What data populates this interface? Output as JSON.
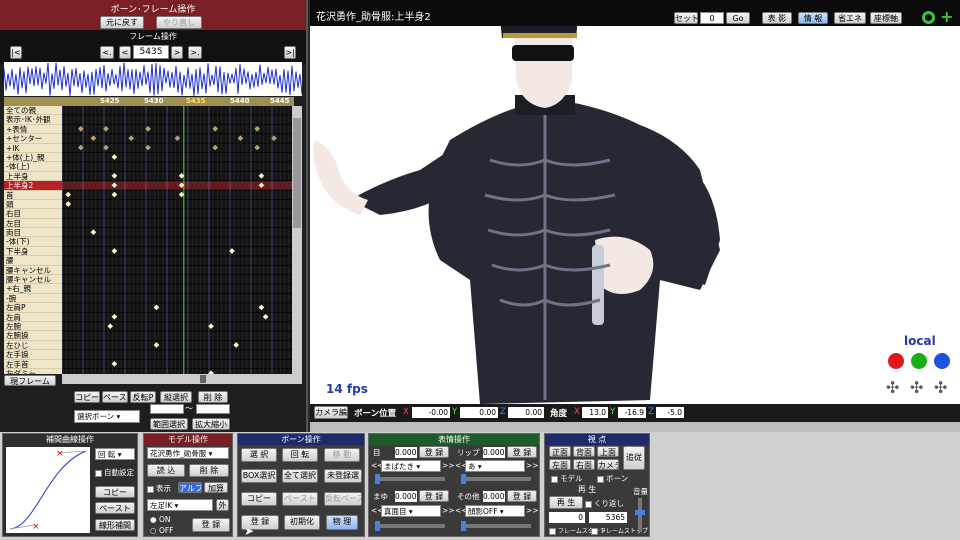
{
  "bone_frame_panel": {
    "title": "ボーン･フレーム操作",
    "undo_label": "元に戻す",
    "redo_label": "やり直し"
  },
  "frame_ops": {
    "title": "フレーム操作",
    "first_label": "|<",
    "prev_key_label": "<.",
    "prev_label": "<",
    "frame_value": "5435",
    "next_label": ">",
    "next_key_label": ">.",
    "last_label": ">|"
  },
  "timeline": {
    "frame_ticks": [
      "5425",
      "5430",
      "5435",
      "5440",
      "5445"
    ],
    "bones": [
      "全ての親",
      "表示･IK･外観",
      "+表情",
      "+センター",
      "+IK",
      "+体(上)_親",
      "-体(上)",
      "上半身",
      "上半身2",
      "首",
      "頭",
      "右目",
      "左目",
      "両目",
      "-体(下)",
      "下半身",
      "腰",
      "腰キャンセル",
      "腰キャンセル",
      "+右_親",
      "-腕",
      "左肩P",
      "左肩",
      "左腕",
      "左腕捩",
      "左ひじ",
      "左手捩",
      "左手首",
      "左ダミー"
    ],
    "current_frame_label": "現フレーム",
    "copy_label": "コピー",
    "paste_label": "ペースト",
    "reverse_paste_label": "反転P",
    "vertical_select_label": "縦選択",
    "delete_label": "削 除",
    "select_bone_label": "選択ボーン",
    "range_tilde": "～",
    "range_select_label": "範囲選択",
    "zoom_label": "拡大縮小"
  },
  "viewport": {
    "title": "花沢勇作_勛骨服:上半身2",
    "set_label": "セット",
    "set_value": "0",
    "go_label": "Go",
    "shadow_label": "表 影",
    "info_label": "情 報",
    "energy_label": "省エネ",
    "axis_label": "座標軸",
    "fps": "14 fps",
    "local_label": "local"
  },
  "position_bar": {
    "camera_label": "カメラ編",
    "pos_title": "ボーン位置",
    "x_label": "X",
    "x": "-0.00",
    "y_label": "Y",
    "y": "0.00",
    "z_label": "Z",
    "z": "0.00",
    "angle_title": "角度",
    "ax": "13.0",
    "ay": "-16.9",
    "az": "-5.0"
  },
  "interp_panel": {
    "title": "補間曲線操作",
    "rotate_select": "回 転",
    "auto_label": "自動設定",
    "copy_label": "コピー",
    "paste_label": "ペースト",
    "linear_label": "線形補間"
  },
  "model_panel": {
    "title": "モデル操作",
    "model_select": "花沢勇作_勛骨服",
    "load_label": "読 込",
    "delete_label": "削 除",
    "display_label": "表示",
    "alpha_label": "アルファ",
    "add_label": "加算",
    "ik_select": "左足IK",
    "outer_label": "外",
    "on_label": "ON",
    "off_label": "OFF",
    "register_label": "登 録"
  },
  "bone_panel": {
    "title": "ボーン操作",
    "select_label": "選 択",
    "rotate_label": "回 転",
    "move_label": "移 動",
    "box_select_label": "BOX選択",
    "select_all_label": "全て選択",
    "unreg_select_label": "未登録選",
    "copy_label": "コピー",
    "paste_label": "ペースト",
    "reverse_paste_label": "反転ペースト",
    "register_label": "登 録",
    "reset_label": "初期化",
    "physics_label": "物 理"
  },
  "morph_panel": {
    "title": "表情操作",
    "eye_label": "目",
    "eye_value": "0.000",
    "eye_select": "まばたき",
    "lip_label": "リップ",
    "lip_value": "0.000",
    "lip_select": "あ",
    "brow_label": "まゆ",
    "brow_value": "0.000",
    "brow_select": "真面目",
    "other_label": "その他",
    "other_value": "0.000",
    "other_select": "顔影OFF",
    "register_label": "登 録",
    "prev_label": "<<",
    "next_label": ">>"
  },
  "view_panel": {
    "title": "視 点",
    "front_label": "正面",
    "back_label": "背面",
    "top_label": "上面",
    "follow_label": "追従",
    "left_label": "左面",
    "right_label": "右面",
    "camera_label": "カメラ",
    "model_label": "モデル",
    "bone_label": "ボーン"
  },
  "play_panel": {
    "title": "再 生",
    "play_label": "再 生",
    "repeat_label": "くり返し",
    "volume_label": "音量",
    "from_value": "0",
    "to_value": "5365",
    "frame_start_label": "フレームスタート",
    "frame_stop_label": "フレームストップ"
  },
  "colors": {
    "panel_title_red": "#7a1f24",
    "panel_title_blue": "#1f2a6a",
    "panel_title_green": "#1f5a2a",
    "selected_row": "#b8202a",
    "wave": "#2030d0",
    "fps_text": "#2638b0"
  }
}
